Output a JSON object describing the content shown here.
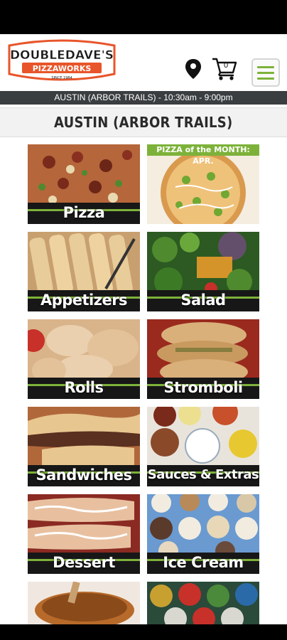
{
  "brand": {
    "name_line1": "DOUBLEDAVE'S",
    "name_line2": "PIZZAWORKS",
    "since": "SINCE 1984",
    "colors": {
      "orange": "#e8552a",
      "green": "#7db23a",
      "dark": "#3a3e41"
    }
  },
  "header": {
    "cart_count": "0",
    "location_icon": "map-pin-icon",
    "cart_icon": "shopping-cart-icon",
    "menu_icon": "hamburger-menu-icon"
  },
  "store_info": "AUSTIN (ARBOR TRAILS) - 10:30am - 9:00pm",
  "location_title": "AUSTIN (ARBOR TRAILS)",
  "pizza_of_month": "PIZZA of the MONTH: APR.",
  "categories": [
    {
      "label": "Pizza"
    },
    {
      "label": ""
    },
    {
      "label": "Appetizers"
    },
    {
      "label": "Salad"
    },
    {
      "label": "Rolls"
    },
    {
      "label": "Stromboli"
    },
    {
      "label": "Sandwiches"
    },
    {
      "label": "Sauces & Extras"
    },
    {
      "label": "Dessert"
    },
    {
      "label": "Ice Cream"
    }
  ]
}
